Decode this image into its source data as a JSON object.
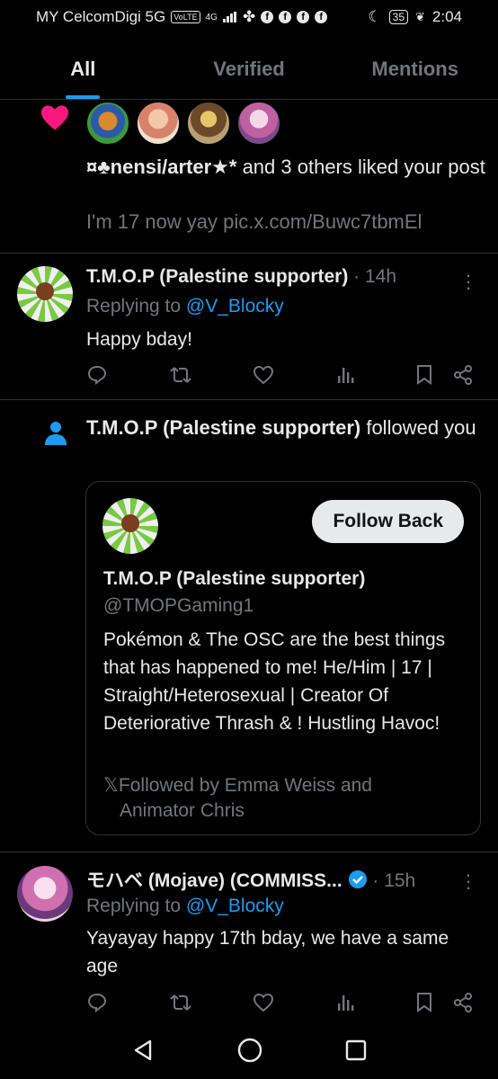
{
  "status_bar": {
    "carrier": "MY CelcomDigi 5G",
    "volte": "VoLTE",
    "network": "4G",
    "battery": "35",
    "time": "2:04"
  },
  "tabs": [
    {
      "label": "All",
      "active": true
    },
    {
      "label": "Verified",
      "active": false
    },
    {
      "label": "Mentions",
      "active": false
    }
  ],
  "like_notification": {
    "actor": "¤♣nensi/arter★*",
    "text": " and 3 others liked your post",
    "post_preview": "I'm 17 now yay pic.x.com/Buwc7tbmEl",
    "avatar_colors": [
      "#3b7a3a",
      "#d9826b",
      "#8a6a3a",
      "#c98ab4"
    ]
  },
  "tweet1": {
    "name": "T.M.O.P (Palestine supporter)",
    "time": " · 14h",
    "replying_to_label": "Replying to ",
    "replying_to_handle": "@V_Blocky",
    "body": "Happy bday!"
  },
  "follow_notification": {
    "actor": "T.M.O.P (Palestine supporter)",
    "text": " followed you",
    "card": {
      "button": "Follow Back",
      "name": "T.M.O.P (Palestine supporter)",
      "handle": "@TMOPGaming1",
      "bio": "Pokémon & The OSC are the best things that has happened to me! He/Him | 17 | Straight/Heterosexual | Creator Of Deteriorative Thrash & ! Hustling Havoc!",
      "followed_by_line1": "Followed by Emma Weiss and",
      "followed_by_line2": "Animator Chris"
    }
  },
  "tweet2": {
    "name": "モハベ (Mojave) (COMMISS...",
    "time": " · 15h",
    "replying_to_label": "Replying to ",
    "replying_to_handle": "@V_Blocky",
    "body": "Yayayay happy 17th bday, we have a same age"
  },
  "colors": {
    "accent": "#1d9bf0",
    "like": "#f91880",
    "muted": "#71767b",
    "text": "#e7e9ea"
  }
}
